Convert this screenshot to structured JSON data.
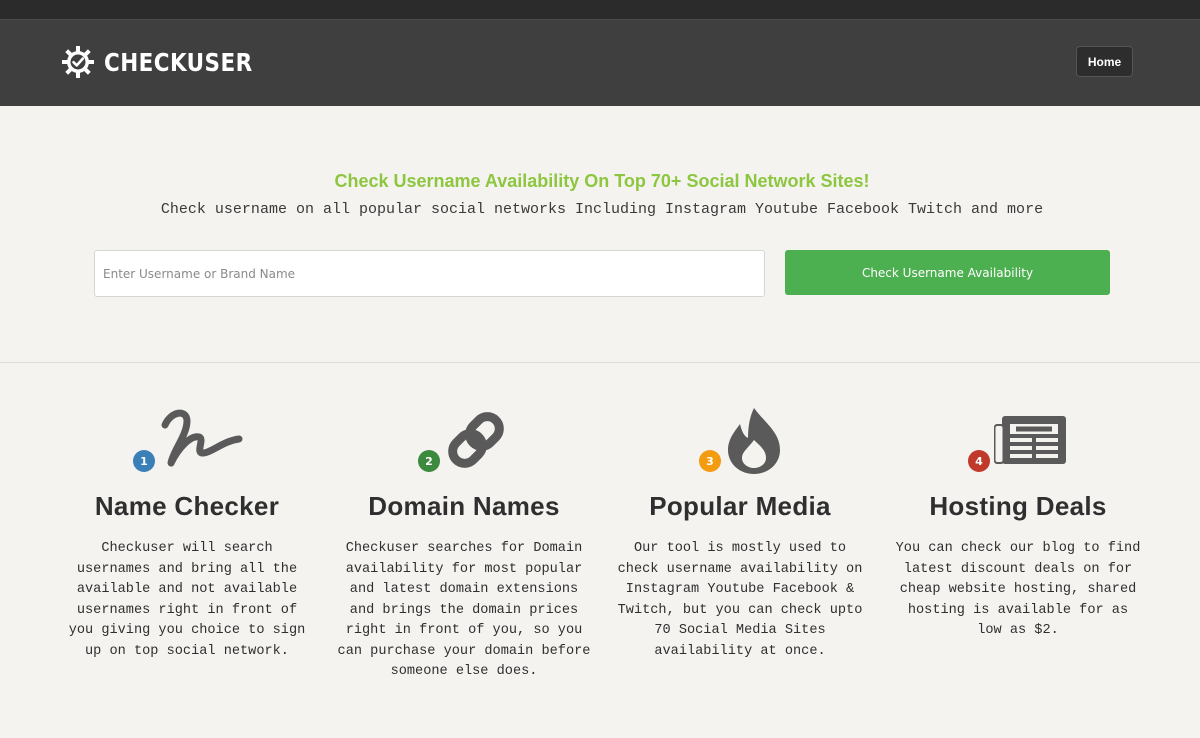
{
  "header": {
    "logo_text": "CHECKUSER",
    "nav_home": "Home"
  },
  "hero": {
    "title": "Check Username Availability On Top 70+ Social Network Sites!",
    "subtitle": "Check username on all popular social networks Including Instagram Youtube Facebook Twitch and more",
    "input_placeholder": "Enter Username or Brand Name",
    "input_value": "",
    "button_label": "Check Username Availability"
  },
  "features": [
    {
      "number": "1",
      "badge_color": "#3a7fb8",
      "icon": "signature-icon",
      "title": "Name Checker",
      "text": "Checkuser will search usernames and bring all the available and not available usernames right in front of you giving you choice to sign up on top social network."
    },
    {
      "number": "2",
      "badge_color": "#3b8a3e",
      "icon": "link-icon",
      "title": "Domain Names",
      "text": "Checkuser searches for Domain availability for most popular and latest domain extensions and brings the domain prices right in front of you, so you can purchase your domain before someone else does."
    },
    {
      "number": "3",
      "badge_color": "#f39c12",
      "icon": "fire-icon",
      "title": "Popular Media",
      "text": "Our tool is mostly used to check username availability on Instagram Youtube Facebook & Twitch, but you can check upto 70 Social Media Sites availability at once."
    },
    {
      "number": "4",
      "badge_color": "#c0392b",
      "icon": "newspaper-icon",
      "title": "Hosting Deals",
      "text": "You can check our blog to find latest discount deals on for cheap website hosting, shared hosting is available for as low as $2."
    }
  ],
  "colors": {
    "header_bg": "#3f3f3f",
    "accent_green": "#8dc63f",
    "button_green": "#4caf50",
    "icon_gray": "#5a5a5a"
  }
}
